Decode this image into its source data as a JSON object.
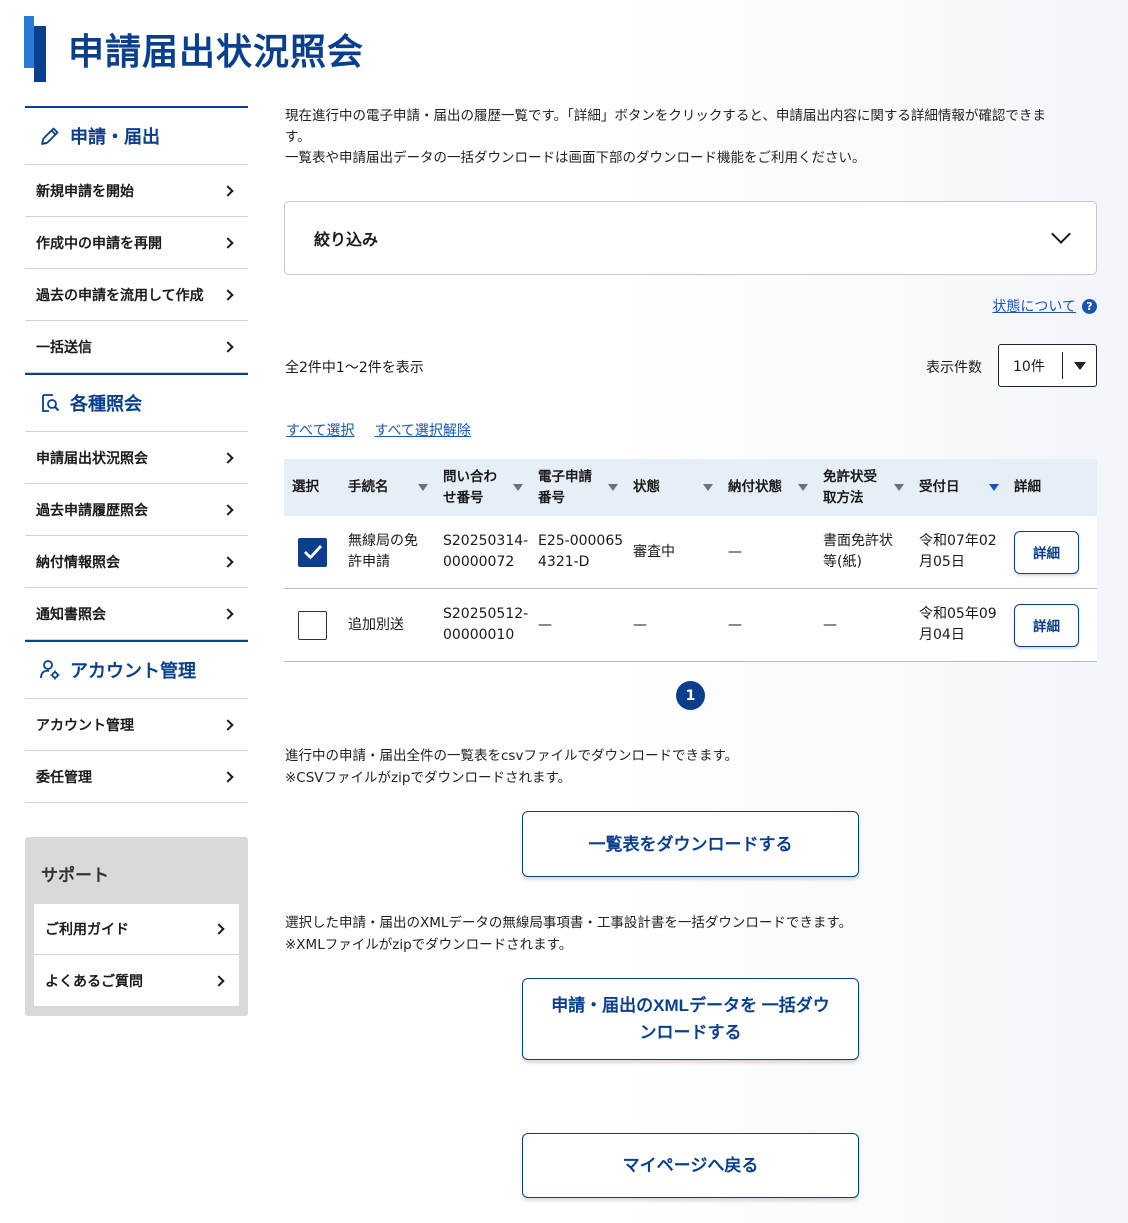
{
  "page": {
    "title": "申請届出状況照会"
  },
  "sidebar": {
    "sections": [
      {
        "title": "申請・届出",
        "icon": "pencil-icon",
        "items": [
          "新規申請を開始",
          "作成中の申請を再開",
          "過去の申請を流用して作成",
          "一括送信"
        ]
      },
      {
        "title": "各種照会",
        "icon": "document-search-icon",
        "items": [
          "申請届出状況照会",
          "過去申請履歴照会",
          "納付情報照会",
          "通知書照会"
        ]
      },
      {
        "title": "アカウント管理",
        "icon": "user-gear-icon",
        "items": [
          "アカウント管理",
          "委任管理"
        ]
      }
    ],
    "support": {
      "title": "サポート",
      "items": [
        "ご利用ガイド",
        "よくあるご質問"
      ]
    }
  },
  "main": {
    "intro": [
      "現在進行中の電子申請・届出の履歴一覧です。「詳細」ボタンをクリックすると、申請届出内容に関する詳細情報が確認できま",
      "す。",
      "一覧表や申請届出データの一括ダウンロードは画面下部のダウンロード機能をご利用ください。"
    ],
    "filter_label": "絞り込み",
    "status_link": "状態について",
    "count_text": "全2件中1〜2件を表示",
    "perpage_label": "表示件数",
    "perpage_value": "10件",
    "select_all": "すべて選択",
    "deselect_all": "すべて選択解除",
    "table": {
      "headers": [
        {
          "label": "選択",
          "sortable": false
        },
        {
          "label": "手続名",
          "sortable": true
        },
        {
          "label": "問い合わせ番号",
          "lines": [
            "問い合わ",
            "せ番号"
          ],
          "sortable": true
        },
        {
          "label": "電子申請番号",
          "lines": [
            "電子申請",
            "番号"
          ],
          "sortable": true
        },
        {
          "label": "状態",
          "sortable": true
        },
        {
          "label": "納付状態",
          "sortable": true
        },
        {
          "label": "免許状受取方法",
          "lines": [
            "免許状受",
            "取方法"
          ],
          "sortable": true
        },
        {
          "label": "受付日",
          "sortable": true,
          "active": true
        },
        {
          "label": "詳細",
          "sortable": false
        }
      ],
      "rows": [
        {
          "checked": true,
          "procedure": [
            "無線局の免",
            "許申請"
          ],
          "inquiry": [
            "S20250314-",
            "00000072"
          ],
          "app_no": [
            "E25-000065",
            "4321-D"
          ],
          "status": "審査中",
          "payment": "—",
          "receive": [
            "書面免許状",
            "等(紙)"
          ],
          "date": [
            "令和07年02",
            "月05日"
          ],
          "detail": "詳細"
        },
        {
          "checked": false,
          "procedure": [
            "追加別送"
          ],
          "inquiry": [
            "S20250512-",
            "00000010"
          ],
          "app_no": [
            "—"
          ],
          "status": "—",
          "payment": "—",
          "receive": [
            "—"
          ],
          "date": [
            "令和05年09",
            "月04日"
          ],
          "detail": "詳細"
        }
      ]
    },
    "pager": {
      "current": "1"
    },
    "csv_note": [
      "進行中の申請・届出全件の一覧表をcsvファイルでダウンロードできます。",
      "※CSVファイルがzipでダウンロードされます。"
    ],
    "csv_button": "一覧表をダウンロードする",
    "xml_note": [
      "選択した申請・届出のXMLデータの無線局事項書・工事設計書を一括ダウンロードできます。",
      "※XMLファイルがzipでダウンロードされます。"
    ],
    "xml_button": [
      "申請・届出のXMLデータを 一括ダウ",
      "ンロードする"
    ],
    "back_button": "マイページへ戻る"
  },
  "colors": {
    "primary": "#0a3f8e",
    "accent": "#2a7ad6",
    "link": "#1a55b5",
    "header_bg": "#e6eef8"
  }
}
